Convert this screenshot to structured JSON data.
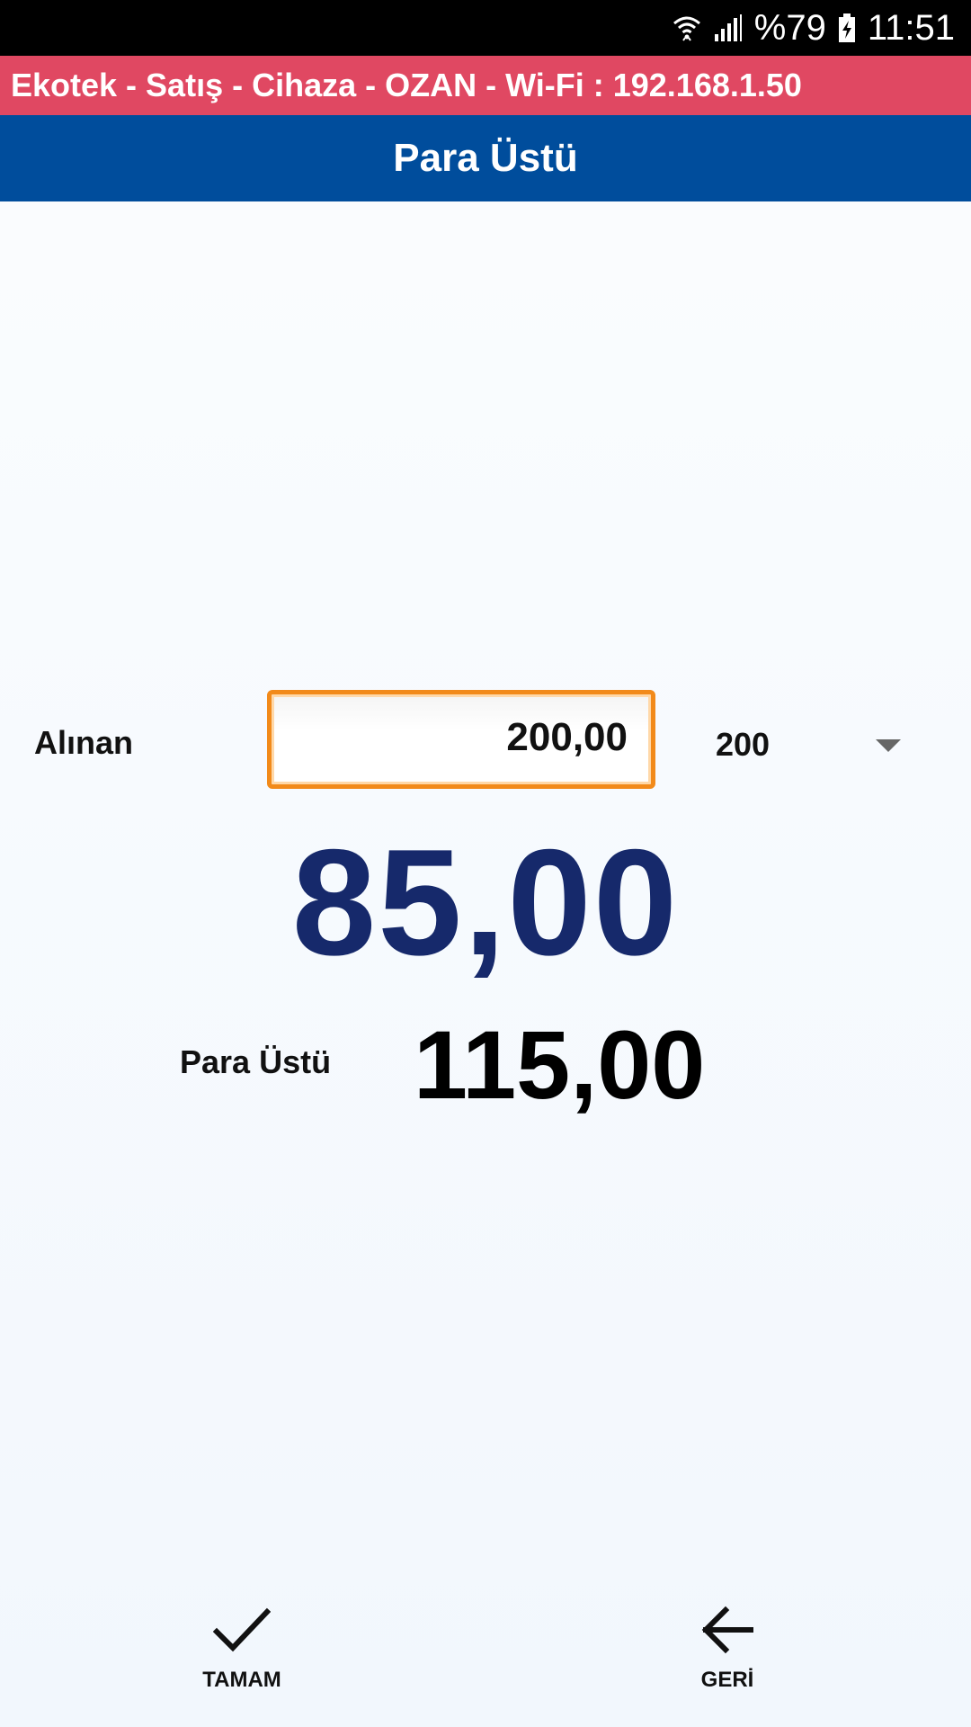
{
  "status_bar": {
    "battery": "%79",
    "time": "11:51",
    "icons": [
      "wifi-icon",
      "signal-icon",
      "battery-charging-icon"
    ]
  },
  "app_bar": {
    "text": "Ekotek - Satış - Cihaza - OZAN - Wi-Fi : 192.168.1.50",
    "color": "#e04862"
  },
  "title_bar": {
    "title": "Para Üstü",
    "color": "#004d9c"
  },
  "payment": {
    "received_label": "Alınan",
    "received_value": "200,00",
    "denomination_selected": "200",
    "total": "85,00",
    "change_label": "Para Üstü",
    "change_value": "115,00"
  },
  "actions": {
    "ok_label": "TAMAM",
    "back_label": "GERİ"
  },
  "colors": {
    "total_text": "#16296b",
    "input_border": "#f28a1a"
  }
}
